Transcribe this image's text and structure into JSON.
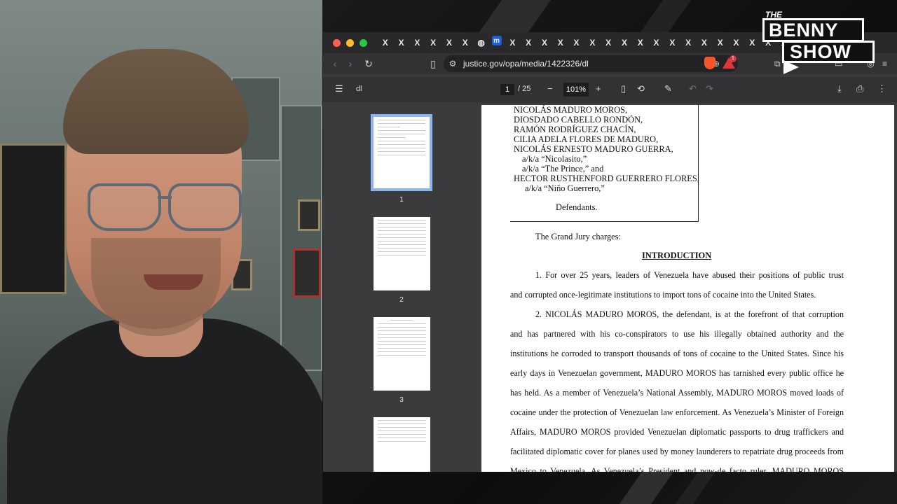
{
  "show": {
    "logo_the": "THE",
    "logo_benny": "BENNY",
    "logo_show": "SHOW"
  },
  "browser": {
    "tab_icons": [
      "X",
      "X",
      "X",
      "X",
      "X",
      "X",
      "globe",
      "m",
      "X",
      "X",
      "X",
      "X",
      "X",
      "X",
      "X",
      "X",
      "X",
      "X",
      "X",
      "X",
      "X",
      "X",
      "X",
      "X",
      "X",
      "X",
      "X"
    ],
    "tab_x": "X",
    "tab_m": "m",
    "url": "justice.gov/opa/media/1422326/dl",
    "shield_badge": "1"
  },
  "pdf": {
    "filename": "dl",
    "current_page": "1",
    "total_pages": "/ 25",
    "zoom": "101%",
    "thumbnails": [
      "1",
      "2",
      "3"
    ]
  },
  "document": {
    "caption_lines": [
      "NICOLÁS MADURO MOROS,",
      "DIOSDADO CABELLO RONDÓN,",
      "RAMÓN RODRÍGUEZ CHACÍN,",
      "CILIA ADELA FLORES DE MADURO,",
      "NICOLÁS ERNESTO MADURO GUERRA,",
      "a/k/a “Nicolasito,”",
      "a/k/a “The Prince,” and",
      "HECTOR RUSTHENFORD GUERRERO FLORES,",
      "a/k/a “Niño Guerrero,”"
    ],
    "defendants_label": "Defendants.",
    "grand_jury": "The Grand Jury charges:",
    "heading": "INTRODUCTION",
    "body_lines": [
      "1.          For over 25 years, leaders of Venezuela have abused their positions of public trust",
      "and corrupted once-legitimate institutions to import tons of cocaine into the United States.",
      "2.          NICOLÁS MADURO MOROS, the defendant, is at the forefront of that corruption",
      "and has partnered with his co-conspirators to use his illegally obtained authority and the",
      "institutions he corroded to transport thousands of tons of cocaine to the United States. Since his",
      "early days in Venezuelan government, MADURO MOROS has tarnished every public office he",
      "has held. As a member of Venezuela’s National Assembly, MADURO MOROS moved loads of",
      "cocaine under the protection of Venezuelan law enforcement. As Venezuela’s Minister of Foreign",
      "Affairs, MADURO MOROS provided Venezuelan diplomatic passports to drug traffickers and",
      "facilitated diplomatic cover for planes used by money launderers to repatriate drug proceeds from",
      "Mexico to Venezuela. As Venezuela’s President and now-de facto ruler, MADURO MOROS"
    ]
  }
}
